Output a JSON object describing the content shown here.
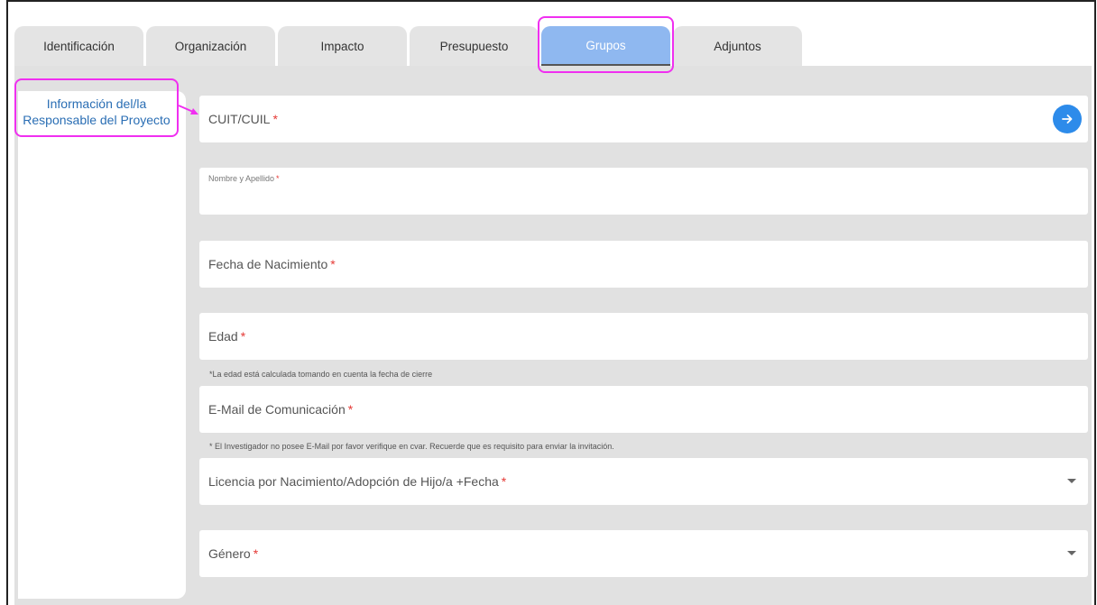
{
  "tabs": [
    {
      "label": "Identificación"
    },
    {
      "label": "Organización"
    },
    {
      "label": "Impacto"
    },
    {
      "label": "Presupuesto"
    },
    {
      "label": "Grupos"
    },
    {
      "label": "Adjuntos"
    }
  ],
  "active_tab": "Grupos",
  "sidebar": {
    "item_line1": "Información del/la",
    "item_line2": "Responsable del Proyecto"
  },
  "form": {
    "cuit": {
      "label": "CUIT/CUIL",
      "required": "*"
    },
    "nombre": {
      "label": "Nombre y Apellido",
      "required": "*"
    },
    "fecha": {
      "label": "Fecha de Nacimiento",
      "required": "*"
    },
    "edad": {
      "label": "Edad",
      "required": "*",
      "hint": "*La edad está calculada tomando en cuenta la fecha de cierre"
    },
    "email": {
      "label": "E-Mail de Comunicación",
      "required": "*",
      "hint": "* El Investigador no posee E-Mail por favor verifique en cvar. Recuerde que es requisito para enviar la invitación."
    },
    "licencia": {
      "label": "Licencia por Nacimiento/Adopción de Hijo/a +Fecha",
      "required": "*"
    },
    "genero": {
      "label": "Género",
      "required": "*"
    }
  },
  "icons": {
    "go": "arrow-right-icon",
    "dropdown": "caret-down-icon"
  },
  "colors": {
    "accent": "#2d8bea",
    "active_tab": "#8fb8f0",
    "highlight": "#f02ff0",
    "required": "#e53935",
    "link": "#2a6eb4"
  }
}
